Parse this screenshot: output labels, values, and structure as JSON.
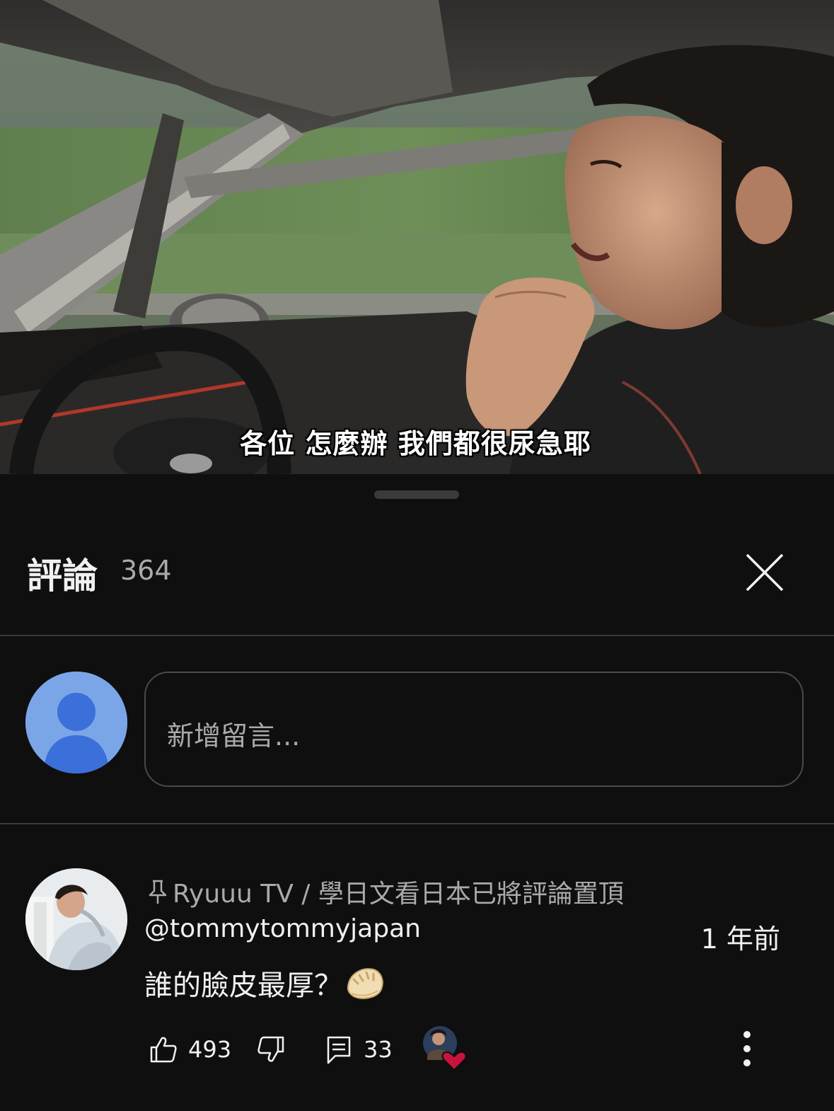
{
  "video": {
    "subtitle": "各位 怎麼辦 我們都很尿急耶"
  },
  "comments_panel": {
    "title": "評論",
    "count": "364",
    "close_icon": "close-icon"
  },
  "composer": {
    "placeholder": "新增留言..."
  },
  "comment": {
    "pinned_by": "Ryuuu TV / 學日文看日本已將評論置頂",
    "author": "@tommytommyjapan",
    "timestamp": "1 年前",
    "text": "誰的臉皮最厚？",
    "emoji": "dumpling",
    "like_count": "493",
    "reply_count": "33",
    "icons": [
      "pin-icon",
      "thumbs-up-icon",
      "thumbs-down-icon",
      "reply-icon",
      "creator-heart-icon",
      "more-vert-icon"
    ]
  },
  "colors": {
    "background": "#0f0f0f",
    "divider": "#3a3a3a",
    "secondary_text": "#aaaaaa",
    "default_avatar": "#7aa6e8",
    "heart": "#c8143c"
  }
}
